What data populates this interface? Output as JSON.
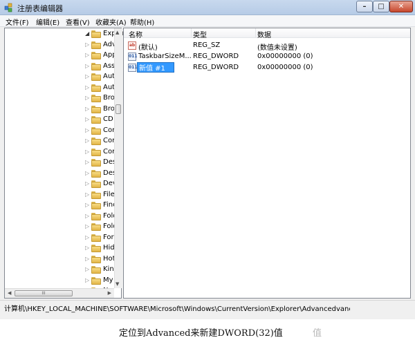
{
  "window": {
    "title": "注册表编辑器",
    "minimize_label": "–",
    "maximize_label": "□",
    "close_label": "✕"
  },
  "menu": [
    "文件(F)",
    "编辑(E)",
    "查看(V)",
    "收藏夹(A)",
    "帮助(H)"
  ],
  "tree": {
    "items": [
      {
        "label": "Explor",
        "expanded": true
      },
      {
        "label": "Adv"
      },
      {
        "label": "App"
      },
      {
        "label": "Ass"
      },
      {
        "label": "Aut"
      },
      {
        "label": "Aut"
      },
      {
        "label": "Bro"
      },
      {
        "label": "Bro"
      },
      {
        "label": "CD"
      },
      {
        "label": "Cor"
      },
      {
        "label": "Cor"
      },
      {
        "label": "Cor"
      },
      {
        "label": "Des"
      },
      {
        "label": "Des"
      },
      {
        "label": "Dev"
      },
      {
        "label": "File"
      },
      {
        "label": "Finc"
      },
      {
        "label": "Fold"
      },
      {
        "label": "Fold"
      },
      {
        "label": "For"
      },
      {
        "label": "Hid"
      },
      {
        "label": "Hot"
      },
      {
        "label": "Kin"
      },
      {
        "label": "My"
      },
      {
        "label": "Nev"
      }
    ],
    "hscroll_thumb_label": "III"
  },
  "list": {
    "columns": [
      "名称",
      "类型",
      "数据"
    ],
    "rows": [
      {
        "name": "(默认)",
        "type": "REG_SZ",
        "data": "(数值未设置)",
        "icon": "string-value-icon",
        "badge": "ab"
      },
      {
        "name": "TaskbarSizeM...",
        "type": "REG_DWORD",
        "data": "0x00000000 (0)",
        "icon": "dword-value-icon",
        "badge": "011"
      },
      {
        "name": "新值 #1",
        "type": "REG_DWORD",
        "data": "0x00000000 (0)",
        "icon": "dword-value-icon",
        "badge": "011",
        "editing": true
      }
    ]
  },
  "status": {
    "path": "计算机\\HKEY_LOCAL_MACHINE\\SOFTWARE\\Microsoft\\Windows\\CurrentVersion\\Explorer\\Advancedvanc"
  },
  "caption": {
    "text": "定位到Advanced来新建DWORD(32)值",
    "ghost": "值"
  }
}
